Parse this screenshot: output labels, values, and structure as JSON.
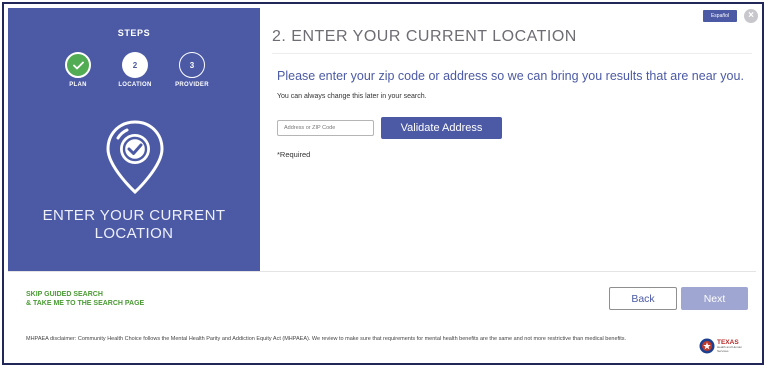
{
  "language_button": "Español",
  "close_glyph": "×",
  "steps_panel": {
    "title": "STEPS",
    "steps": [
      {
        "number": "",
        "label": "PLAN",
        "state": "complete"
      },
      {
        "number": "2",
        "label": "LOCATION",
        "state": "current"
      },
      {
        "number": "3",
        "label": "PROVIDER",
        "state": "upcoming"
      }
    ],
    "heading": "ENTER YOUR CURRENT LOCATION",
    "graphic_icon": "location-pin-check-icon"
  },
  "main": {
    "title": "2. ENTER YOUR CURRENT LOCATION",
    "prompt": "Please enter your zip code or address so we can bring you results that are near you.",
    "subprompt": "You can always change this later in your search.",
    "address_input": {
      "value": "",
      "placeholder": "Address or ZIP Code"
    },
    "validate_label": "Validate Address",
    "required_note": "*Required"
  },
  "footer": {
    "skip_line1": "SKIP GUIDED SEARCH",
    "skip_line2": "& TAKE ME TO THE SEARCH PAGE",
    "back_label": "Back",
    "next_label": "Next",
    "disclaimer": "MHPAEA disclaimer: Community Health Choice follows the Mental Health Parity and Addiction Equity Act (MHPAEA). We review to make sure that requirements for mental health benefits are the same and not more restrictive than medical benefits.",
    "logo_title": "TEXAS",
    "logo_sub1": "Health and Human",
    "logo_sub2": "Services"
  },
  "colors": {
    "brand_blue": "#4c5aa5",
    "success_green": "#52ac53",
    "link_green": "#4b9a35",
    "next_disabled": "#9fa6d1"
  }
}
